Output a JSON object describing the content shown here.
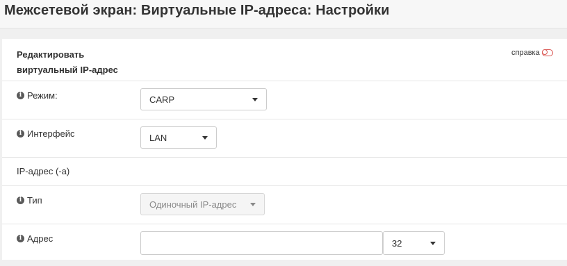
{
  "page": {
    "title": "Межсетевой экран: Виртуальные IP-адреса: Настройки"
  },
  "panel": {
    "title_line1": "Редактировать",
    "title_line2": "виртуальный IP-адрес",
    "help_label": "справка",
    "help_icon": "toggle-off-icon",
    "accent_color": "#d9534f"
  },
  "form": {
    "mode": {
      "label": "Режим:",
      "value": "CARP",
      "icon": "info-icon"
    },
    "interface": {
      "label": "Интерфейс",
      "value": "LAN",
      "icon": "info-icon"
    },
    "section_ip": {
      "label": "IP-адрес (-а)"
    },
    "type": {
      "label": "Тип",
      "value": "Одиночный IP-адрес",
      "disabled": true,
      "icon": "info-icon"
    },
    "address": {
      "label": "Адрес",
      "value": "",
      "icon": "info-icon",
      "mask": "32"
    }
  }
}
